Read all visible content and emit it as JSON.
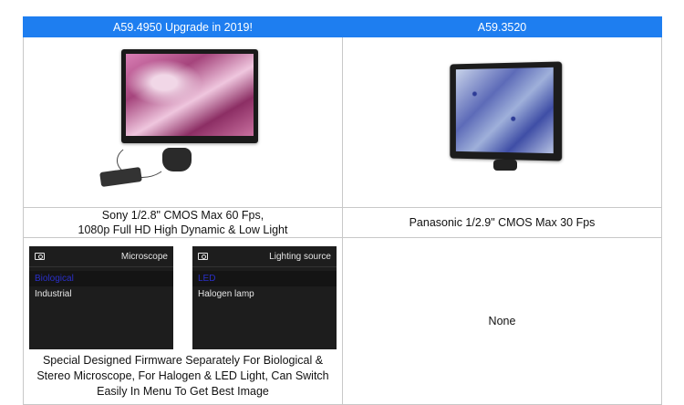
{
  "headers": [
    "A59.4950  Upgrade in 2019!",
    "A59.3520"
  ],
  "specs": {
    "col1_line1": "Sony 1/2.8\" CMOS Max 60 Fps,",
    "col1_line2": "1080p Full HD High Dynamic & Low Light",
    "col2": "Panasonic 1/2.9\" CMOS Max 30 Fps"
  },
  "firmware": {
    "menu1": {
      "title": "Microscope",
      "options": [
        "Biological",
        "Industrial"
      ],
      "selected": 0
    },
    "menu2": {
      "title": "Lighting source",
      "options": [
        "LED",
        "Halogen lamp"
      ],
      "selected": 0
    },
    "desc_line1": "Special Designed Firmware Separately For Biological &",
    "desc_line2": "Stereo Microscope, For Halogen & LED Light, Can Switch",
    "desc_line3": "Easily In Menu To Get Best Image",
    "col2": "None"
  },
  "colors": {
    "header_bg": "#1e7ef0",
    "menu_selected": "#2a2fc8"
  },
  "icons": [
    "camera-icon"
  ]
}
